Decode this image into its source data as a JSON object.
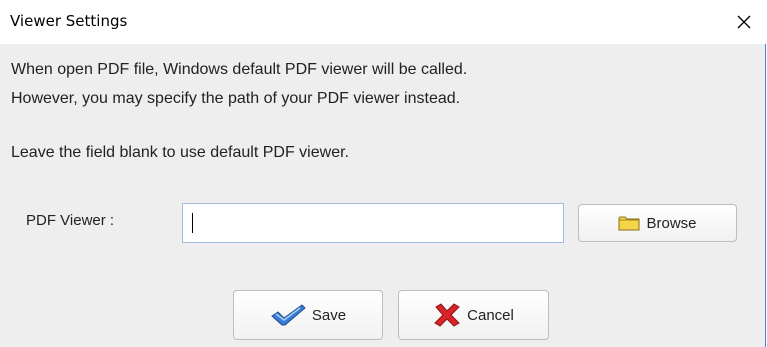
{
  "window": {
    "title": "Viewer Settings",
    "close_icon": "close-icon"
  },
  "messages": {
    "line1": "When open PDF file, Windows default PDF viewer will be called.",
    "line2": "However, you may specify the path of your PDF viewer instead.",
    "line3": "Leave the field blank to use default PDF viewer."
  },
  "pdf_viewer": {
    "label": "PDF Viewer :",
    "value": "",
    "browse_label": "Browse",
    "browse_icon": "folder-icon"
  },
  "actions": {
    "save_label": "Save",
    "save_icon": "checkmark-icon",
    "cancel_label": "Cancel",
    "cancel_icon": "red-x-icon"
  },
  "colors": {
    "dialog_bg": "#eeeeee",
    "input_border": "#9dbde2",
    "window_edge": "#3f82d1",
    "cancel_red": "#d8232a",
    "check_blue": "#3a7bd5",
    "folder_yellow": "#f3d54a"
  }
}
